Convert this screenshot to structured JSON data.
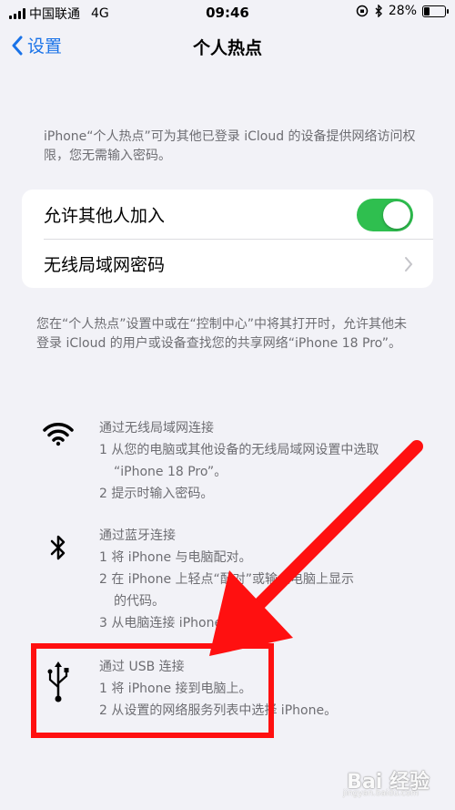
{
  "status_bar": {
    "carrier": "中国联通",
    "network": "4G",
    "time": "09:46",
    "battery_percent": "28%",
    "battery_level": 0.28
  },
  "nav": {
    "back_label": "设置",
    "title": "个人热点"
  },
  "top_description": "iPhone“个人热点”可为其他已登录 iCloud 的设备提供网络访问权限，您无需输入密码。",
  "settings": {
    "allow_others": {
      "label": "允许其他人加入",
      "enabled": true
    },
    "wifi_password": {
      "label": "无线局域网密码"
    }
  },
  "middle_description": "您在“个人热点”设置中或在“控制中心”中将其打开时，允许其他未登录 iCloud 的用户或设备查找您的共享网络“iPhone 18 Pro”。",
  "methods": {
    "wifi": {
      "title": "通过无线局域网连接",
      "step1": "1 从您的电脑或其他设备的无线局域网设置中选取",
      "step1_cont": "“iPhone 18 Pro”。",
      "step2": "2 提示时输入密码。"
    },
    "bluetooth": {
      "title": "通过蓝牙连接",
      "step1": "1 将 iPhone 与电脑配对。",
      "step2": "2 在 iPhone 上轻点“配对”或输入电脑上显示",
      "step2_cont": "的代码。",
      "step3": "3 从电脑连接 iPhone。"
    },
    "usb": {
      "title": "通过 USB 连接",
      "step1": "1 将 iPhone 接到电脑上。",
      "step2": "2 从设置的网络服务列表中选择 iPhone。"
    }
  },
  "annotation_color": "#ff1010",
  "watermark": {
    "text": "Bai 经验",
    "sub": "jingyan.baidu.com"
  }
}
